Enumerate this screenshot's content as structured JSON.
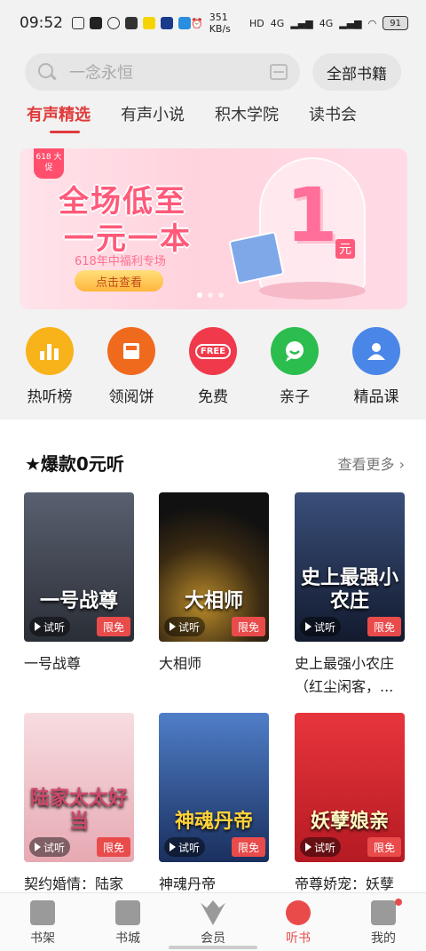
{
  "status_bar": {
    "time": "09:52",
    "net_speed": "351 KB/s",
    "signal1": "4G",
    "signal2": "4G",
    "battery": "91"
  },
  "search": {
    "placeholder": "一念永恒"
  },
  "header": {
    "all_books": "全部书籍"
  },
  "tabs": [
    {
      "label": "有声精选"
    },
    {
      "label": "有声小说"
    },
    {
      "label": "积木学院"
    },
    {
      "label": "读书会"
    }
  ],
  "banner": {
    "tag": "618 大促",
    "title_line1": "全场低至",
    "title_line2": "一元一本",
    "subtitle": "618年中福利专场",
    "button": "点击查看",
    "big_number": "1",
    "unit": "元"
  },
  "categories": [
    {
      "label": "热听榜",
      "icon": "bar-chart-icon",
      "color": "#f8b31a"
    },
    {
      "label": "领阅饼",
      "icon": "envelope-icon",
      "color": "#f06a1e"
    },
    {
      "label": "免费",
      "icon": "free-icon",
      "icon_text": "FREE",
      "color": "#f03a4c"
    },
    {
      "label": "亲子",
      "icon": "chat-icon",
      "color": "#2bbd4e"
    },
    {
      "label": "精品课",
      "icon": "user-card-icon",
      "color": "#4a86e8"
    }
  ],
  "section": {
    "title": "★爆款0元听",
    "see_more": "查看更多 ›"
  },
  "books": [
    {
      "name": "一号战尊",
      "cover_text": "一号战尊",
      "try": "试听",
      "badge": "限免",
      "cover_color": "#3a3f4a"
    },
    {
      "name": "大相师",
      "cover_text": "大相师",
      "try": "试听",
      "badge": "限免",
      "cover_color": "#1c1712"
    },
    {
      "name": "史上最强小农庄（红尘闲客，...",
      "cover_text": "史上最强小农庄",
      "try": "试听",
      "badge": "限免",
      "cover_color": "#1d2a4a"
    },
    {
      "name": "契约婚情：陆家",
      "cover_text": "陆家太太好当",
      "try": "试听",
      "badge": "限免",
      "cover_color": "#f3c9cf"
    },
    {
      "name": "神魂丹帝",
      "cover_text": "神魂丹帝",
      "try": "试听",
      "badge": "限免",
      "cover_color": "#2b4f8a"
    },
    {
      "name": "帝尊娇宠：妖孽",
      "cover_text": "妖孽娘亲",
      "try": "试听",
      "badge": "限免",
      "cover_color": "#d8262e"
    }
  ],
  "bottom_nav": [
    {
      "label": "书架",
      "icon": "bookshelf-icon"
    },
    {
      "label": "书城",
      "icon": "bookmark-icon"
    },
    {
      "label": "会员",
      "icon": "crown-icon"
    },
    {
      "label": "听书",
      "icon": "headphones-icon"
    },
    {
      "label": "我的",
      "icon": "profile-icon"
    }
  ]
}
